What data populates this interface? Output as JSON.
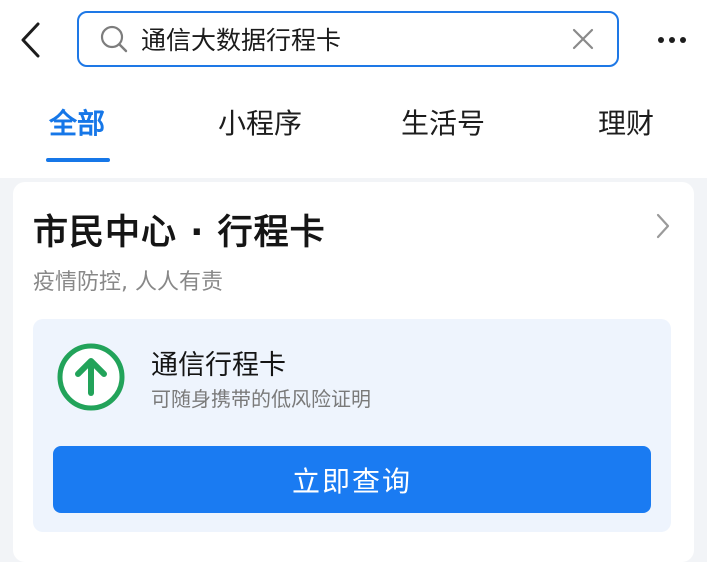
{
  "header": {
    "back_icon": "chevron-left-icon",
    "search": {
      "query": "通信大数据行程卡",
      "search_icon": "search-icon",
      "clear_icon": "close-icon"
    },
    "more_icon": "more-horizontal-icon"
  },
  "tabs": [
    {
      "label": "全部",
      "active": true
    },
    {
      "label": "小程序",
      "active": false
    },
    {
      "label": "生活号",
      "active": false
    },
    {
      "label": "理财",
      "active": false
    }
  ],
  "result_card": {
    "title": "市民中心 · 行程卡",
    "subtitle": "疫情防控, 人人有责",
    "chevron_icon": "chevron-right-icon",
    "service": {
      "icon": "arrow-up-circle-icon",
      "name": "通信行程卡",
      "description": "可随身携带的低风险证明",
      "button_label": "立即查询"
    }
  },
  "colors": {
    "accent": "#1677e8",
    "button": "#1a7bf2",
    "service_bg": "#eef4fd",
    "icon_green": "#22a35a",
    "page_bg": "#f2f4f7"
  }
}
